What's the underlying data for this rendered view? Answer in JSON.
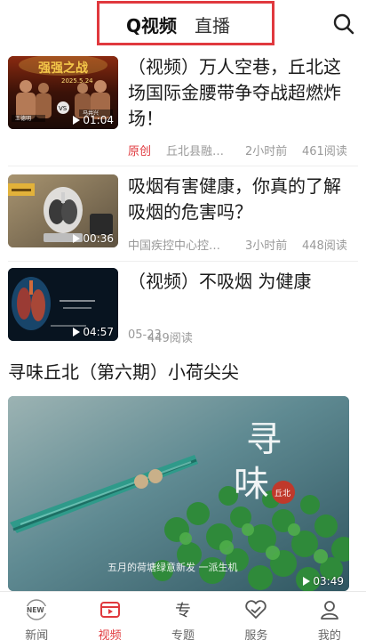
{
  "header": {
    "tab_active": "Q视频",
    "tab_inactive": "直播"
  },
  "news": [
    {
      "title": "（视频）万人空巷，丘北这场国际金腰带争夺战超燃炸场！",
      "duration": "01:04",
      "tag": "原创",
      "source": "丘北县融…",
      "time": "2小时前",
      "reads": "461阅读",
      "thumb_text": [
        "强强之战",
        "2025.5.24",
        "王德明",
        "马井兴"
      ]
    },
    {
      "title": "吸烟有害健康，你真的了解吸烟的危害吗？",
      "duration": "00:36",
      "source": "中国疾控中心控…",
      "time": "3小时前",
      "reads": "448阅读"
    },
    {
      "title": "（视频）不吸烟 为健康",
      "duration": "04:57",
      "date": "05-23",
      "reads": "449阅读"
    }
  ],
  "featured": {
    "title": "寻味丘北（第六期）小荷尖尖",
    "duration": "03:49",
    "calligraphy": [
      "寻",
      "味"
    ],
    "seal": "丘北",
    "subtitle": "五月的荷塘绿意新发 一派生机"
  },
  "nav": [
    {
      "label": "新闻",
      "icon": "news-icon",
      "badge": "NEW"
    },
    {
      "label": "视频",
      "icon": "video-icon",
      "active": true
    },
    {
      "label": "专题",
      "icon": "topic-icon"
    },
    {
      "label": "服务",
      "icon": "service-icon"
    },
    {
      "label": "我的",
      "icon": "profile-icon"
    }
  ],
  "colors": {
    "accent": "#e0393e",
    "meta": "#999999"
  }
}
